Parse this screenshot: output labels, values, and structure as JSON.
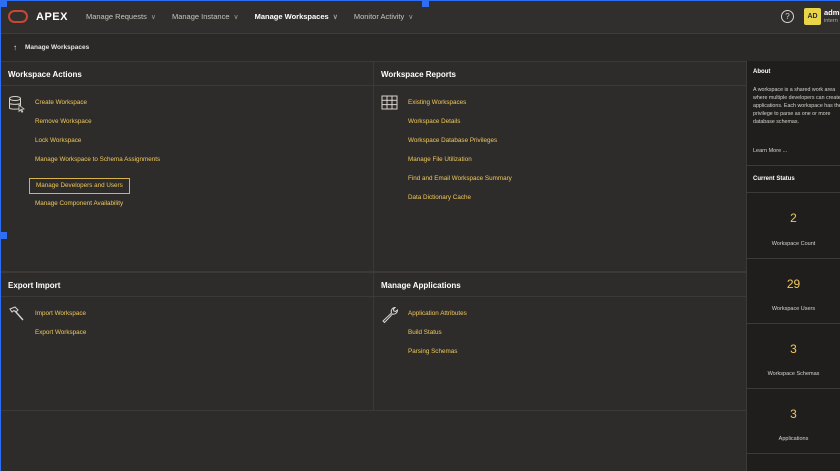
{
  "app": {
    "name": "APEX"
  },
  "nav": [
    {
      "label": "Manage Requests",
      "active": false
    },
    {
      "label": "Manage Instance",
      "active": false
    },
    {
      "label": "Manage Workspaces",
      "active": true
    },
    {
      "label": "Monitor Activity",
      "active": false
    }
  ],
  "user": {
    "initials": "AD",
    "name": "admi",
    "sub": "intern"
  },
  "breadcrumb": {
    "label": "Manage Workspaces"
  },
  "workspace_actions": {
    "title": "Workspace Actions",
    "links": [
      "Create Workspace",
      "Remove Workspace",
      "Lock Workspace",
      "Manage Workspace to Schema Assignments",
      "Manage Developers and Users",
      "Manage Component Availability"
    ]
  },
  "workspace_reports": {
    "title": "Workspace Reports",
    "links": [
      "Existing Workspaces",
      "Workspace Details",
      "Workspace Database Privileges",
      "Manage File Utilization",
      "Find and Email Workspace Summary",
      "Data Dictionary Cache"
    ]
  },
  "export_import": {
    "title": "Export Import",
    "links": [
      "Import Workspace",
      "Export Workspace"
    ]
  },
  "manage_applications": {
    "title": "Manage Applications",
    "links": [
      "Application Attributes",
      "Build Status",
      "Parsing Schemas"
    ]
  },
  "about": {
    "title": "About",
    "text": "A workspace is a shared work area where multiple developers can create applications. Each workspace has the privilege to parse as one or more database schemas.",
    "learn_more": "Learn More ..."
  },
  "current_status": {
    "title": "Current Status",
    "stats": [
      {
        "value": "2",
        "label": "Workspace Count"
      },
      {
        "value": "29",
        "label": "Workspace Users"
      },
      {
        "value": "3",
        "label": "Workspace Schemas"
      },
      {
        "value": "3",
        "label": "Applications"
      }
    ]
  },
  "colors": {
    "accent": "#f0c85c",
    "brand": "#c74634",
    "avatar": "#e8d54a"
  }
}
